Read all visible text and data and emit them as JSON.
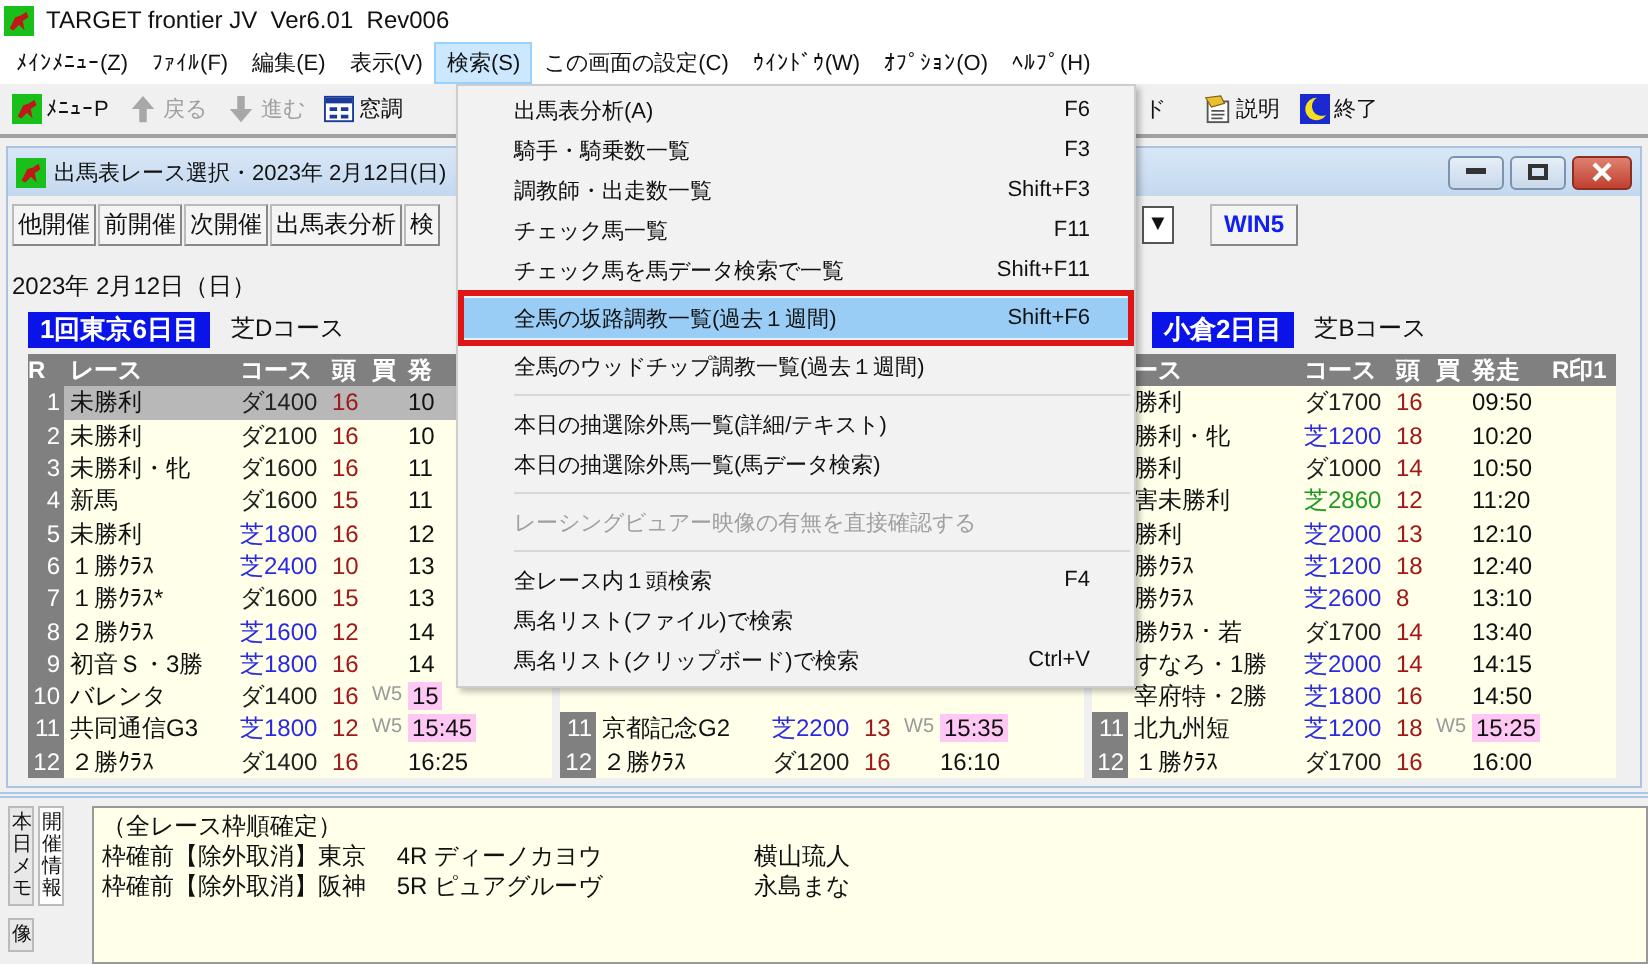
{
  "window": {
    "title": "TARGET frontier JV  Ver6.01  Rev006"
  },
  "menubar": [
    {
      "label": "ﾒｲﾝﾒﾆｭｰ(Z)",
      "selected": false
    },
    {
      "label": "ﾌｧｲﾙ(F)",
      "selected": false
    },
    {
      "label": "編集(E)",
      "selected": false
    },
    {
      "label": "表示(V)",
      "selected": false
    },
    {
      "label": "検索(S)",
      "selected": true
    },
    {
      "label": "この画面の設定(C)",
      "selected": false
    },
    {
      "label": "ｳｲﾝﾄﾞｳ(W)",
      "selected": false
    },
    {
      "label": "ｵﾌﾟｼｮﾝ(O)",
      "selected": false
    },
    {
      "label": "ﾍﾙﾌﾟ(H)",
      "selected": false
    }
  ],
  "toolbar": {
    "left": [
      {
        "kind": "menu",
        "label": "ﾒﾆｭｰP",
        "disabled": false
      },
      {
        "kind": "back",
        "label": "戻る",
        "disabled": true
      },
      {
        "kind": "forward",
        "label": "進む",
        "disabled": true
      },
      {
        "kind": "window",
        "label": "窓調",
        "disabled": false
      }
    ],
    "right": [
      {
        "kind": "text",
        "label": "ド",
        "disabled": false
      },
      {
        "kind": "help",
        "label": "説明",
        "disabled": false
      },
      {
        "kind": "exit",
        "label": "終了",
        "disabled": false
      }
    ]
  },
  "child_window": {
    "title": "出馬表レース選択・2023年 2月12日(日)",
    "buttons": [
      "他開催",
      "前開催",
      "次開催",
      "出馬表分析",
      "検"
    ],
    "dropdown": {
      "arrow": "▼"
    },
    "win5_button": "WIN5",
    "date": "2023年 2月12日（日）",
    "venues": [
      {
        "heading": "1回東京6日目",
        "course_note": "芝Dコース",
        "columns": {
          "r": "R",
          "name": "レース",
          "course": "コース",
          "heads": "頭",
          "bet": "買",
          "time": "発"
        },
        "rows": [
          {
            "r": "1",
            "name": "未勝利",
            "course": "ダ1400",
            "color": "#222222",
            "heads": "16",
            "time": "10",
            "highlight": false,
            "selected": true
          },
          {
            "r": "2",
            "name": "未勝利",
            "course": "ダ2100",
            "color": "#222222",
            "heads": "16",
            "time": "10",
            "highlight": false,
            "selected": false
          },
          {
            "r": "3",
            "name": "未勝利・牝",
            "course": "ダ1600",
            "color": "#222222",
            "heads": "16",
            "time": "11",
            "highlight": false,
            "selected": false
          },
          {
            "r": "4",
            "name": "新馬",
            "course": "ダ1600",
            "color": "#222222",
            "heads": "15",
            "time": "11",
            "highlight": false,
            "selected": false
          },
          {
            "r": "5",
            "name": "未勝利",
            "course": "芝1800",
            "color": "#2a2ae0",
            "heads": "16",
            "time": "12",
            "highlight": false,
            "selected": false
          },
          {
            "r": "6",
            "name": "１勝ｸﾗｽ",
            "course": "芝2400",
            "color": "#2a2ae0",
            "heads": "10",
            "time": "13",
            "highlight": false,
            "selected": false
          },
          {
            "r": "7",
            "name": "１勝ｸﾗｽ*",
            "course": "ダ1600",
            "color": "#222222",
            "heads": "15",
            "time": "13",
            "highlight": false,
            "selected": false
          },
          {
            "r": "8",
            "name": "２勝ｸﾗｽ",
            "course": "芝1600",
            "color": "#2a2ae0",
            "heads": "12",
            "time": "14",
            "highlight": false,
            "selected": false
          },
          {
            "r": "9",
            "name": "初音Ｓ・3勝",
            "course": "芝1800",
            "color": "#2a2ae0",
            "heads": "16",
            "time": "14",
            "highlight": false,
            "selected": false
          },
          {
            "r": "10",
            "name": "バレンタ",
            "course": "ダ1400",
            "color": "#222222",
            "heads": "16",
            "bet": "W5",
            "time": "15",
            "highlight": true,
            "selected": false
          },
          {
            "r": "11",
            "name": "共同通信G3",
            "course": "芝1800",
            "color": "#2a2ae0",
            "heads": "12",
            "bet": "W5",
            "time": "15:45",
            "highlight": true,
            "selected": false
          },
          {
            "r": "12",
            "name": "２勝ｸﾗｽ",
            "course": "ダ1400",
            "color": "#222222",
            "heads": "16",
            "time": "16:25",
            "highlight": false,
            "selected": false
          }
        ]
      },
      {
        "rows": [
          {
            "r": "11",
            "name": "京都記念G2",
            "course": "芝2200",
            "color": "#2a2ae0",
            "heads": "13",
            "bet": "W5",
            "time": "15:35",
            "highlight": true,
            "selected": false
          },
          {
            "r": "12",
            "name": "２勝ｸﾗｽ",
            "course": "ダ1200",
            "color": "#222222",
            "heads": "16",
            "time": "16:10",
            "highlight": false,
            "selected": false
          }
        ]
      },
      {
        "heading": "小倉2日目",
        "course_note": "芝Bコース",
        "columns": {
          "name": "ース",
          "course": "コース",
          "heads": "頭",
          "bet": "買",
          "time": "発走",
          "mark": "R印1"
        },
        "rows": [
          {
            "name": "勝利",
            "course": "ダ1700",
            "color": "#222222",
            "heads": "16",
            "time": "09:50",
            "highlight": false,
            "selected": false
          },
          {
            "name": "勝利・牝",
            "course": "芝1200",
            "color": "#2a2ae0",
            "heads": "18",
            "time": "10:20",
            "highlight": false,
            "selected": false
          },
          {
            "name": "勝利",
            "course": "ダ1000",
            "color": "#222222",
            "heads": "14",
            "time": "10:50",
            "highlight": false,
            "selected": false
          },
          {
            "name": "害未勝利",
            "course": "芝2860",
            "color": "#1f9a1f",
            "heads": "12",
            "time": "11:20",
            "highlight": false,
            "selected": false
          },
          {
            "name": "勝利",
            "course": "芝2000",
            "color": "#2a2ae0",
            "heads": "13",
            "time": "12:10",
            "highlight": false,
            "selected": false
          },
          {
            "name": "勝ｸﾗｽ",
            "course": "芝1200",
            "color": "#2a2ae0",
            "heads": "18",
            "time": "12:40",
            "highlight": false,
            "selected": false
          },
          {
            "name": "勝ｸﾗｽ",
            "course": "芝2600",
            "color": "#2a2ae0",
            "heads": "8",
            "time": "13:10",
            "highlight": false,
            "selected": false
          },
          {
            "name": "勝ｸﾗｽ・若",
            "course": "ダ1700",
            "color": "#222222",
            "heads": "14",
            "time": "13:40",
            "highlight": false,
            "selected": false
          },
          {
            "name": "すなろ・1勝",
            "course": "芝2000",
            "color": "#2a2ae0",
            "heads": "14",
            "time": "14:15",
            "highlight": false,
            "selected": false
          },
          {
            "name": "宰府特・2勝",
            "course": "芝1800",
            "color": "#2a2ae0",
            "heads": "16",
            "time": "14:50",
            "highlight": false,
            "selected": false
          },
          {
            "r": "11",
            "name": "北九州短",
            "course": "芝1200",
            "color": "#2a2ae0",
            "heads": "18",
            "bet": "W5",
            "time": "15:25",
            "highlight": true,
            "selected": false
          },
          {
            "r": "12",
            "name": "１勝ｸﾗｽ",
            "course": "ダ1700",
            "color": "#222222",
            "heads": "16",
            "time": "16:00",
            "highlight": false,
            "selected": false
          }
        ]
      }
    ]
  },
  "side_tabs": [
    {
      "label": "本日メモ",
      "selected": false
    },
    {
      "label": "像",
      "selected": false
    },
    {
      "label": "開催情報",
      "selected": true
    }
  ],
  "memo": {
    "lines": [
      {
        "text": "（全レース枠順確定）"
      },
      {
        "text": "枠確前【除外取消】東京　 4R ディーノカヨウ",
        "jockey": "横山琉人"
      },
      {
        "text": "枠確前【除外取消】阪神　 5R ピュアグルーヴ",
        "jockey": "永島まな"
      }
    ]
  },
  "search_menu": {
    "items": [
      {
        "kind": "item",
        "label": "出馬表分析(A)",
        "shortcut": "F6",
        "selected": false,
        "disabled": false
      },
      {
        "kind": "item",
        "label": "騎手・騎乗数一覧",
        "shortcut": "F3",
        "selected": false,
        "disabled": false
      },
      {
        "kind": "item",
        "label": "調教師・出走数一覧",
        "shortcut": "Shift+F3",
        "selected": false,
        "disabled": false
      },
      {
        "kind": "item",
        "label": "チェック馬一覧",
        "shortcut": "F11",
        "selected": false,
        "disabled": false
      },
      {
        "kind": "item",
        "label": "チェック馬を馬データ検索で一覧",
        "shortcut": "Shift+F11",
        "selected": false,
        "disabled": false
      },
      {
        "kind": "item",
        "label": "全馬の坂路調教一覧(過去１週間)",
        "shortcut": "Shift+F6",
        "selected": true,
        "disabled": false
      },
      {
        "kind": "item",
        "label": "全馬のウッドチップ調教一覧(過去１週間)",
        "selected": false,
        "disabled": false
      },
      {
        "kind": "separator"
      },
      {
        "kind": "item",
        "label": "本日の抽選除外馬一覧(詳細/テキスト)",
        "selected": false,
        "disabled": false
      },
      {
        "kind": "item",
        "label": "本日の抽選除外馬一覧(馬データ検索)",
        "selected": false,
        "disabled": false
      },
      {
        "kind": "separator"
      },
      {
        "kind": "item",
        "label": "レーシングビュアー映像の有無を直接確認する",
        "selected": false,
        "disabled": true
      },
      {
        "kind": "separator"
      },
      {
        "kind": "item",
        "label": "全レース内１頭検索",
        "shortcut": "F4",
        "selected": false,
        "disabled": false
      },
      {
        "kind": "item",
        "label": "馬名リスト(ファイル)で検索",
        "selected": false,
        "disabled": false
      },
      {
        "kind": "item",
        "label": "馬名リスト(クリップボード)で検索",
        "shortcut": "Ctrl+V",
        "selected": false,
        "disabled": false
      }
    ]
  }
}
